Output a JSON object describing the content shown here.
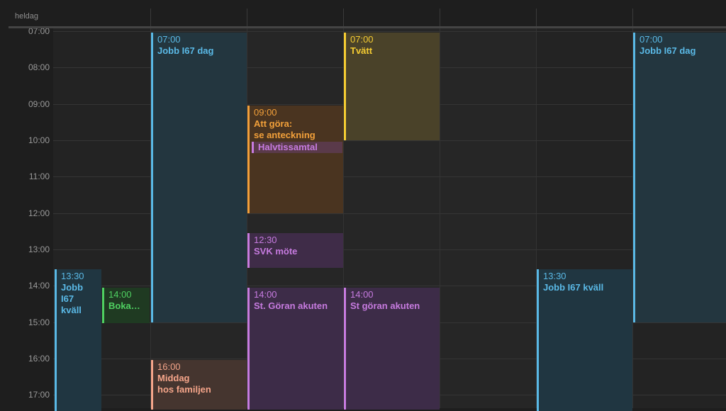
{
  "allday_label": "heldag",
  "hours": [
    "07:00",
    "08:00",
    "09:00",
    "10:00",
    "11:00",
    "12:00",
    "13:00",
    "14:00",
    "15:00",
    "16:00",
    "17:00"
  ],
  "colors": {
    "blue": "#5ab9e6",
    "green": "#4fd061",
    "orange": "#f2a03a",
    "yellow": "#f5cc32",
    "purple": "#c77be0",
    "salmon": "#f5a58a"
  },
  "events": {
    "mon_job": {
      "time": "13:30",
      "title": "Jobb\nI67\nkväll"
    },
    "mon_booking": {
      "time": "14:00",
      "title": "Boka…"
    },
    "tue_job": {
      "time": "07:00",
      "title": "Jobb I67 dag"
    },
    "tue_dinner": {
      "time": "16:00",
      "title": "Middag\nhos familjen"
    },
    "wed_todo": {
      "time": "09:00",
      "title": "Att göra:\nse anteckning"
    },
    "wed_half": {
      "title": "Halvtissamtal"
    },
    "wed_svk": {
      "time": "12:30",
      "title": "SVK möte"
    },
    "wed_stgoran": {
      "time": "14:00",
      "title": "St. Göran akuten"
    },
    "thu_laundry": {
      "time": "07:00",
      "title": "Tvätt"
    },
    "thu_stgoran": {
      "time": "14:00",
      "title": "St göran akuten"
    },
    "sat_job": {
      "time": "13:30",
      "title": "Jobb I67 kväll"
    },
    "sun_job": {
      "time": "07:00",
      "title": "Jobb I67 dag"
    }
  }
}
